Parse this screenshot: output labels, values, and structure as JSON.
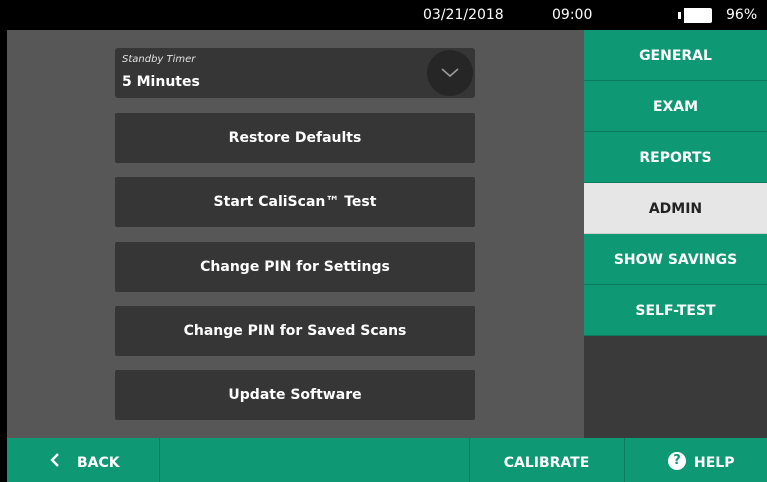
{
  "status_bar": {
    "date": "03/21/2018",
    "time": "09:00",
    "battery_percent": "96%",
    "battery_level": 0.96
  },
  "standby": {
    "label": "Standby Timer",
    "value": "5 Minutes"
  },
  "actions": [
    "Restore Defaults",
    "Start CaliScan™ Test",
    "Change PIN for Settings",
    "Change PIN for Saved Scans",
    "Update Software"
  ],
  "tabs": [
    {
      "label": "GENERAL",
      "active": false
    },
    {
      "label": "EXAM",
      "active": false
    },
    {
      "label": "REPORTS",
      "active": false
    },
    {
      "label": "ADMIN",
      "active": true
    },
    {
      "label": "SHOW SAVINGS",
      "active": false
    },
    {
      "label": "SELF-TEST",
      "active": false
    }
  ],
  "bottom_bar": {
    "back": "BACK",
    "calibrate": "CALIBRATE",
    "help": "HELP",
    "help_icon_glyph": "?"
  },
  "colors": {
    "accent": "#0e9874",
    "panel": "#575757",
    "button": "#363636",
    "active_tab": "#e6e6e6"
  }
}
